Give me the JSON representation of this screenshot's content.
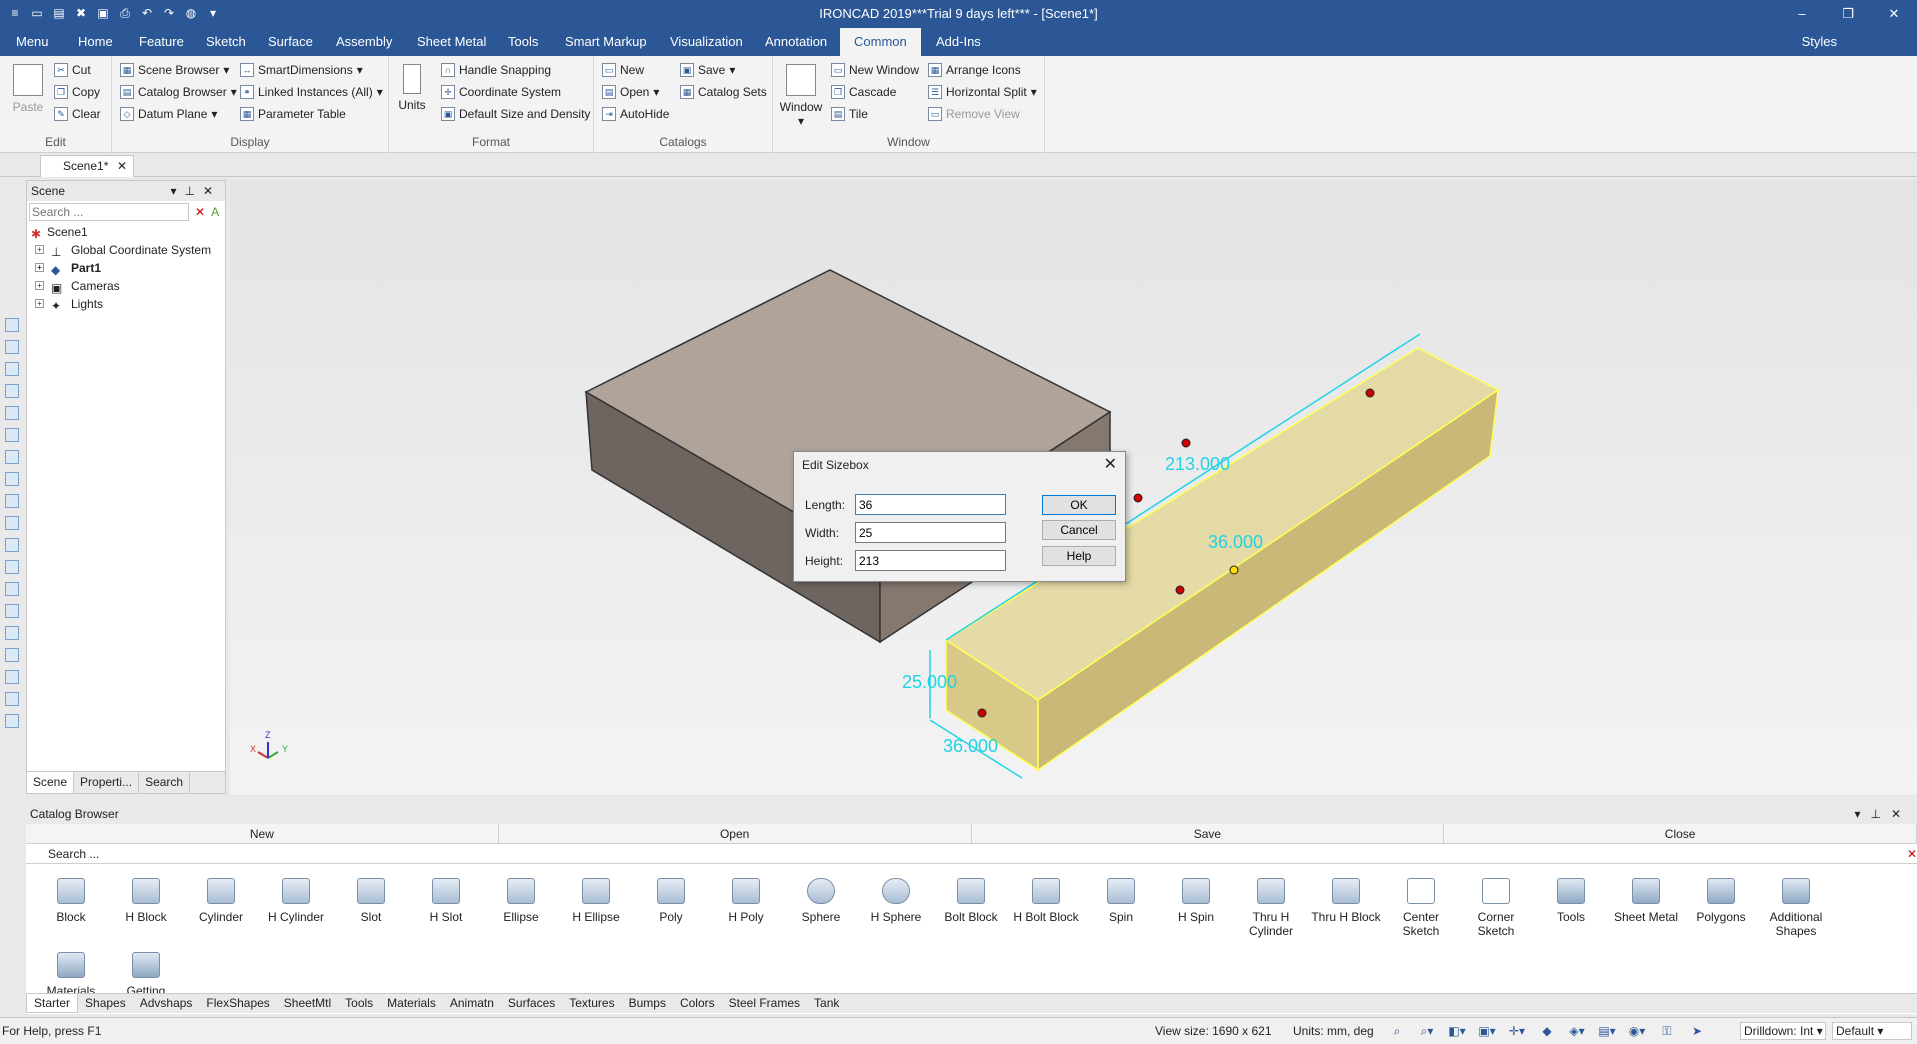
{
  "app": {
    "title": "IRONCAD 2019***Trial 9 days left*** - [Scene1*]",
    "window_controls": [
      "–",
      "❐",
      "✕"
    ]
  },
  "menu_tabs": [
    "Menu",
    "Home",
    "Feature",
    "Sketch",
    "Surface",
    "Assembly",
    "Sheet Metal",
    "Tools",
    "Smart Markup",
    "Visualization",
    "Annotation",
    "Common",
    "Add-Ins"
  ],
  "active_tab": "Common",
  "styles_label": "Styles",
  "ribbon": {
    "edit": {
      "label": "Edit",
      "paste": "Paste",
      "cut": "Cut",
      "copy": "Copy",
      "clear": "Clear"
    },
    "display": {
      "label": "Display",
      "scene_browser": "Scene Browser",
      "catalog_browser": "Catalog Browser",
      "datum_plane": "Datum Plane",
      "smart_dimensions": "SmartDimensions",
      "linked_instances": "Linked Instances (All)",
      "parameter_table": "Parameter Table"
    },
    "format": {
      "label": "Format",
      "units": "Units",
      "handle_snapping": "Handle Snapping",
      "coordinate_system": "Coordinate System",
      "default_size": "Default Size and Density"
    },
    "catalogs": {
      "label": "Catalogs",
      "new": "New",
      "open": "Open",
      "autohide": "AutoHide",
      "save": "Save",
      "catalog_sets": "Catalog Sets"
    },
    "window": {
      "label": "Window",
      "window": "Window",
      "new_window": "New Window",
      "cascade": "Cascade",
      "tile": "Tile",
      "arrange_icons": "Arrange Icons",
      "horizontal_split": "Horizontal Split",
      "remove_view": "Remove View"
    }
  },
  "doc_tab": "Scene1*",
  "scene_panel": {
    "title": "Scene",
    "search_placeholder": "Search ...",
    "tree": [
      {
        "label": "Scene1",
        "root": true
      },
      {
        "label": "Global Coordinate System"
      },
      {
        "label": "Part1",
        "bold": true
      },
      {
        "label": "Cameras"
      },
      {
        "label": "Lights"
      }
    ],
    "tabs": [
      "Scene",
      "Properti...",
      "Search"
    ]
  },
  "viewport": {
    "dims": {
      "height_dim": "213.000",
      "width_dim": "36.000",
      "depth_dim": "25.000",
      "length_dim": "36.000"
    },
    "axis_labels": {
      "x": "X",
      "y": "Y",
      "z": "Z"
    }
  },
  "dialog": {
    "title": "Edit Sizebox",
    "length_label": "Length:",
    "width_label": "Width:",
    "height_label": "Height:",
    "length_value": "36",
    "width_value": "25",
    "height_value": "213",
    "ok": "OK",
    "cancel": "Cancel",
    "help": "Help"
  },
  "catalog": {
    "title": "Catalog Browser",
    "buttons": [
      "New",
      "Open",
      "Save",
      "Close"
    ],
    "search_placeholder": "Search ...",
    "items": [
      "Block",
      "H Block",
      "Cylinder",
      "H Cylinder",
      "Slot",
      "H Slot",
      "Ellipse",
      "H Ellipse",
      "Poly",
      "H Poly",
      "Sphere",
      "H Sphere",
      "Bolt Block",
      "H Bolt Block",
      "Spin",
      "H Spin",
      "Thru H Cylinder",
      "Thru H Block",
      "Center Sketch",
      "Corner Sketch",
      "Tools",
      "Sheet Metal",
      "Polygons",
      "Additional Shapes",
      "Materials",
      "Getting"
    ],
    "tabs": [
      "Starter",
      "Shapes",
      "Advshaps",
      "FlexShapes",
      "SheetMtl",
      "Tools",
      "Materials",
      "Animatn",
      "Surfaces",
      "Textures",
      "Bumps",
      "Colors",
      "Steel Frames",
      "Tank"
    ]
  },
  "status": {
    "help": "For Help, press F1",
    "view_size": "View size: 1690 x 621",
    "units": "Units: mm, deg",
    "drilldown": "Drilldown: Int",
    "mode": "Default"
  },
  "colors": {
    "titlebar": "#2b5797",
    "dim_cyan": "#22d3e6",
    "brown_block": "#a89890",
    "yellow_box": "#ebe1a8",
    "yellow_edge": "#ffff55"
  }
}
